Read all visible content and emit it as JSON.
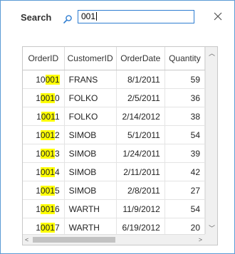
{
  "search": {
    "label": "Search",
    "value": "001",
    "highlight": "001"
  },
  "grid": {
    "columns": [
      "OrderID",
      "CustomerID",
      "OrderDate",
      "Quantity"
    ],
    "rows": [
      {
        "order_id": "10001",
        "customer_id": "FRANS",
        "order_date": "8/1/2011",
        "quantity": "59"
      },
      {
        "order_id": "10010",
        "customer_id": "FOLKO",
        "order_date": "2/5/2011",
        "quantity": "36"
      },
      {
        "order_id": "10011",
        "customer_id": "FOLKO",
        "order_date": "2/14/2012",
        "quantity": "38"
      },
      {
        "order_id": "10012",
        "customer_id": "SIMOB",
        "order_date": "5/1/2011",
        "quantity": "54"
      },
      {
        "order_id": "10013",
        "customer_id": "SIMOB",
        "order_date": "1/24/2011",
        "quantity": "39"
      },
      {
        "order_id": "10014",
        "customer_id": "SIMOB",
        "order_date": "2/11/2011",
        "quantity": "42"
      },
      {
        "order_id": "10015",
        "customer_id": "SIMOB",
        "order_date": "2/8/2011",
        "quantity": "27"
      },
      {
        "order_id": "10016",
        "customer_id": "WARTH",
        "order_date": "11/9/2012",
        "quantity": "54"
      },
      {
        "order_id": "10017",
        "customer_id": "WARTH",
        "order_date": "6/19/2012",
        "quantity": "20"
      }
    ]
  },
  "colors": {
    "accent": "#2e7dd1",
    "window_border": "#5b9bd5",
    "highlight": "#ffff00"
  },
  "icons": {
    "search": "magnifier-icon",
    "close": "close-icon",
    "scroll_up": "chevron-up-icon",
    "scroll_down": "chevron-down-icon",
    "scroll_left": "chevron-left-icon",
    "scroll_right": "chevron-right-icon"
  }
}
